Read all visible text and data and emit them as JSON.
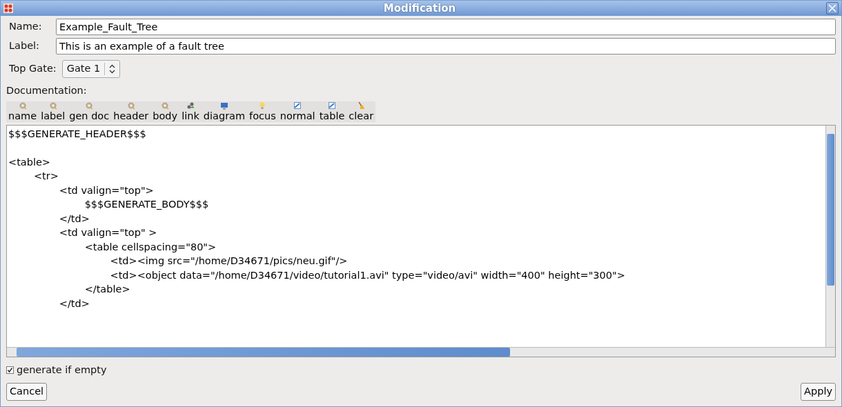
{
  "window": {
    "title": "Modification"
  },
  "fields": [
    {
      "label": "Name:",
      "value": "Example_Fault_Tree"
    },
    {
      "label": "Label:",
      "value": "This is an example of a fault tree"
    }
  ],
  "top_gate": {
    "label": "Top Gate:",
    "value": "Gate 1"
  },
  "documentation": {
    "label": "Documentation:",
    "toolbar": [
      {
        "label": "name",
        "kind": "gear"
      },
      {
        "label": "label",
        "kind": "gear"
      },
      {
        "label": "gen doc",
        "kind": "gear"
      },
      {
        "label": "header",
        "kind": "gear"
      },
      {
        "label": "body",
        "kind": "gear"
      },
      {
        "label": "link",
        "kind": "link"
      },
      {
        "label": "diagram",
        "kind": "monitor"
      },
      {
        "label": "focus",
        "kind": "bulb"
      },
      {
        "label": "normal",
        "kind": "picture"
      },
      {
        "label": "table",
        "kind": "picture"
      },
      {
        "label": "clear",
        "kind": "broom"
      }
    ],
    "lines": [
      {
        "kind": "text",
        "text": "$$$GENERATE_HEADER$$$"
      },
      {
        "kind": "blank"
      },
      {
        "kind": "text",
        "text": "<table>"
      },
      {
        "kind": "text",
        "text": "\t<tr>"
      },
      {
        "kind": "text",
        "text": "\t\t<td valign=\"top\">"
      },
      {
        "kind": "text",
        "text": "\t\t\t$$$GENERATE_BODY$$$"
      },
      {
        "kind": "text",
        "text": "\t\t</td>"
      },
      {
        "kind": "text",
        "text": "\t\t<td valign=\"top\" >"
      },
      {
        "kind": "text",
        "text": "\t\t\t<table cellspacing=\"80\">"
      },
      {
        "kind": "text",
        "text": "\t\t\t\t<td><img src=\"/home/D34671/pics/neu.gif\"/>"
      },
      {
        "kind": "text",
        "text": "\t\t\t\t<td><object data=\"/home/D34671/video/tutorial1.avi\" type=\"video/avi\" width=\"400\" height=\"300\">"
      },
      {
        "kind": "text",
        "text": "\t\t\t</table>"
      },
      {
        "kind": "text",
        "text": "\t\t</td>"
      }
    ]
  },
  "generate_if_empty": {
    "label": "generate if empty",
    "checked": true
  },
  "buttons": [
    {
      "label": "Cancel"
    },
    {
      "label": "Apply"
    }
  ]
}
